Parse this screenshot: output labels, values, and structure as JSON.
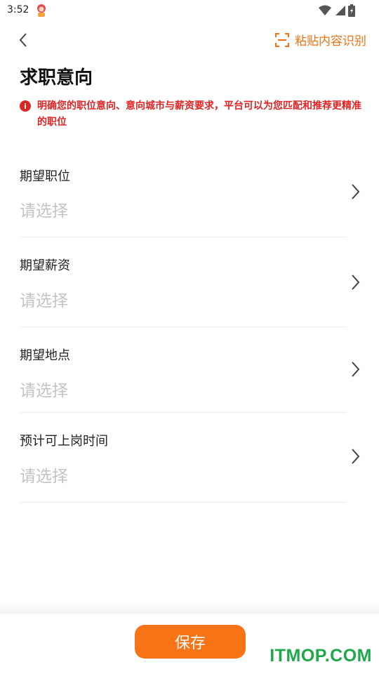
{
  "status_bar": {
    "time": "3:52"
  },
  "header": {
    "paste_label": "粘贴内容识别"
  },
  "page": {
    "title": "求职意向",
    "notice": "明确您的职位意向、意向城市与薪资要求，平台可以为您匹配和推荐更精准的职位"
  },
  "form": {
    "rows": [
      {
        "label": "期望职位",
        "placeholder": "请选择"
      },
      {
        "label": "期望薪资",
        "placeholder": "请选择"
      },
      {
        "label": "期望地点",
        "placeholder": "请选择"
      },
      {
        "label": "预计可上岗时间",
        "placeholder": "请选择"
      }
    ]
  },
  "footer": {
    "save_label": "保存"
  },
  "watermark": "ITMOP.COM",
  "colors": {
    "accent": "#f87316",
    "notice_red": "#e02424",
    "placeholder": "#c4c4c4",
    "watermark": "#1ea84a"
  }
}
